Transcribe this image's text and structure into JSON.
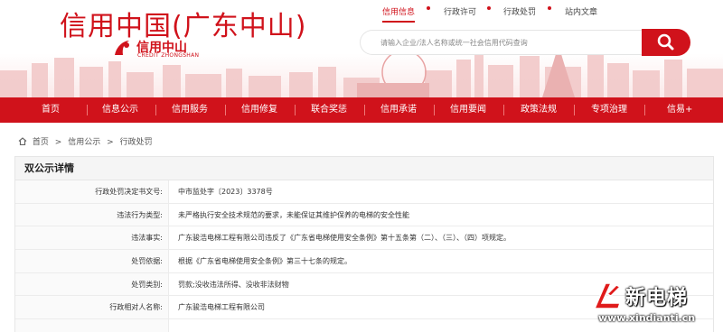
{
  "header": {
    "site_title": "信用中国(广东中山)",
    "logo_cn": "信用中山",
    "logo_en": "CREDIT ZHONGSHAN",
    "top_nav": [
      "信用信息",
      "行政许可",
      "行政处罚",
      "站内文章"
    ],
    "top_nav_active_index": 0,
    "search_placeholder": "请输入企业/法人名称或统一社会信用代码查询",
    "accent_color": "#d0121b"
  },
  "main_nav": [
    "首页",
    "信息公示",
    "信用服务",
    "信用修复",
    "联合奖惩",
    "信用承诺",
    "信用要闻",
    "政策法规",
    "专项治理",
    "信易+"
  ],
  "breadcrumb": [
    "首页",
    "信用公示",
    "行政处罚"
  ],
  "panel": {
    "title": "双公示详情",
    "rows": [
      {
        "label": "行政处罚决定书文号:",
        "value": "中市监处字〔2023〕3378号"
      },
      {
        "label": "违法行为类型:",
        "value": "未严格执行安全技术规范的要求，未能保证其维护保养的电梯的安全性能"
      },
      {
        "label": "违法事实:",
        "value": "广东骏浩电梯工程有限公司违反了《广东省电梯使用安全条例》第十五条第（二）、（三）、（四）项规定。"
      },
      {
        "label": "处罚依据:",
        "value": "根据《广东省电梯使用安全条例》第三十七条的规定。"
      },
      {
        "label": "处罚类别:",
        "value": "罚款;没收违法所得、没收非法财物"
      },
      {
        "label": "行政相对人名称:",
        "value": "广东骏浩电梯工程有限公司"
      }
    ]
  },
  "watermark": {
    "text": "新电梯",
    "url": "www.xindianti.cn"
  }
}
